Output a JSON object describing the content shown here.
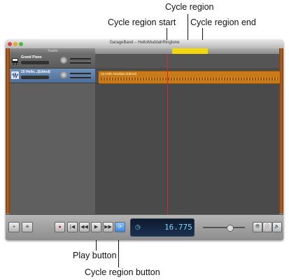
{
  "callouts": {
    "cycle_region": "Cycle region",
    "cycle_region_start": "Cycle region start",
    "cycle_region_end": "Cycle region end",
    "play_button": "Play button",
    "cycle_region_button": "Cycle region button"
  },
  "window": {
    "title": "GarageBand – HelloMuddahRingtone",
    "tracks_header": "Tracks"
  },
  "tracks": [
    {
      "name": "Grand Piano",
      "icon": "piano-icon"
    },
    {
      "name": "15 Hello...(Edited)",
      "icon": "waveform-icon"
    }
  ],
  "timeline": {
    "region_name": "15 Hello Muddah (Edited)"
  },
  "transport": {
    "add_track": "+",
    "record": "●",
    "go_to_start": "|◀",
    "rewind": "◀◀",
    "play": "▶",
    "fast_forward": "▶▶",
    "cycle": "⟳",
    "lcd_time": "16.775",
    "view_buttons": [
      "👁",
      "ⓘ",
      "🔈"
    ]
  },
  "colors": {
    "region": "#c87b18",
    "cycle_region": "#f2d60e",
    "playhead": "#dd2233",
    "cycle_button": "#3a86e0"
  }
}
